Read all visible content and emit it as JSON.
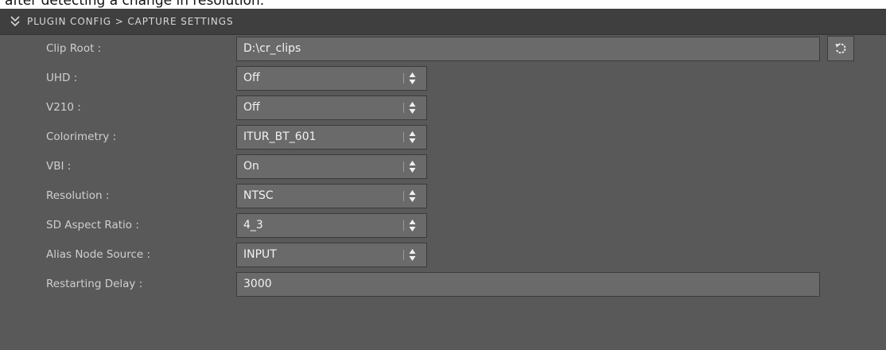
{
  "caption_text": "after detecting a change in resolution.",
  "header": {
    "title": "PLUGIN CONFIG > CAPTURE SETTINGS",
    "collapse_icon": "double-chevron-down-icon"
  },
  "fields": {
    "clip_root": {
      "label": "Clip Root :",
      "value": "D:\\cr_clips",
      "button_icon": "refresh-icon"
    },
    "uhd": {
      "label": "UHD :",
      "value": "Off"
    },
    "v210": {
      "label": "V210 :",
      "value": "Off"
    },
    "colorimetry": {
      "label": "Colorimetry :",
      "value": "ITUR_BT_601"
    },
    "vbi": {
      "label": "VBI :",
      "value": "On"
    },
    "resolution": {
      "label": "Resolution :",
      "value": "NTSC"
    },
    "sd_aspect_ratio": {
      "label": "SD Aspect Ratio :",
      "value": "4_3"
    },
    "alias_node_source": {
      "label": "Alias Node Source :",
      "value": "INPUT"
    },
    "restarting_delay": {
      "label": "Restarting Delay :",
      "value": "3000"
    }
  },
  "colors": {
    "panel_bg": "#595959",
    "header_bg": "#3f3f3f",
    "field_bg": "#6a6a6a",
    "label_text": "#cfcfcf",
    "value_text": "#f2f2f2"
  }
}
